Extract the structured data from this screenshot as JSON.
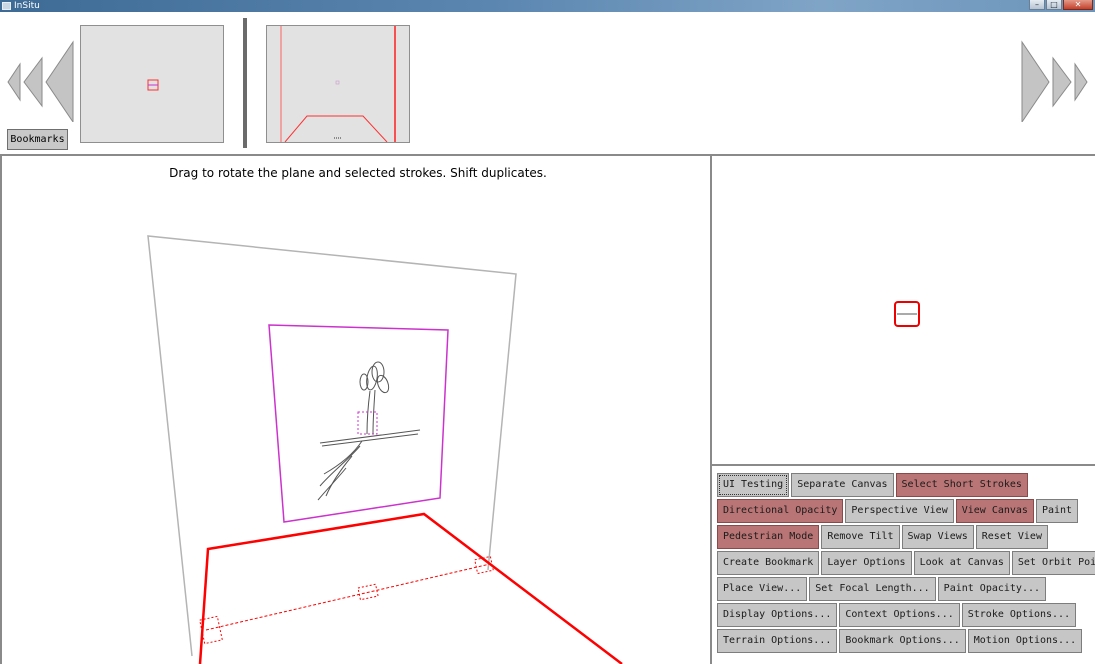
{
  "window": {
    "title": "InSitu",
    "minimize_glyph": "–",
    "maximize_glyph": "□",
    "close_glyph": "✕"
  },
  "top_strip": {
    "bookmarks_label": "Bookmarks",
    "prev_icon": "triple-left-triangles-icon",
    "next_icon": "triple-right-triangles-icon"
  },
  "main_view": {
    "instruction_text": "Drag to rotate the plane and selected strokes. Shift duplicates."
  },
  "colors": {
    "active_button": "#b97575",
    "button": "#c6c6c6",
    "canvas_outline": "#cc33cc",
    "ground_plane": "#ff0000",
    "back_plane": "#b4b4b4"
  },
  "buttons": {
    "rows": [
      [
        {
          "label": "UI Testing",
          "active": false,
          "focused": true
        },
        {
          "label": "Separate Canvas",
          "active": false
        },
        {
          "label": "Select Short Strokes",
          "active": true
        }
      ],
      [
        {
          "label": "Directional Opacity",
          "active": true
        },
        {
          "label": "Perspective View",
          "active": false
        },
        {
          "label": "View Canvas",
          "active": true
        },
        {
          "label": "Paint",
          "active": false
        }
      ],
      [
        {
          "label": "Pedestrian Mode",
          "active": true
        },
        {
          "label": "Remove Tilt",
          "active": false
        },
        {
          "label": "Swap Views",
          "active": false
        },
        {
          "label": "Reset View",
          "active": false
        }
      ],
      [
        {
          "label": "Create Bookmark",
          "active": false
        },
        {
          "label": "Layer Options",
          "active": false
        },
        {
          "label": "Look at Canvas",
          "active": false
        },
        {
          "label": "Set Orbit Point",
          "active": false
        }
      ],
      [
        {
          "label": "Place View...",
          "active": false
        },
        {
          "label": "Set Focal Length...",
          "active": false
        },
        {
          "label": "Paint Opacity...",
          "active": false
        }
      ],
      [
        {
          "label": "Display Options...",
          "active": false
        },
        {
          "label": "Context Options...",
          "active": false
        },
        {
          "label": "Stroke Options...",
          "active": false
        }
      ],
      [
        {
          "label": "Terrain Options...",
          "active": false
        },
        {
          "label": "Bookmark Options...",
          "active": false
        },
        {
          "label": "Motion Options...",
          "active": false
        }
      ]
    ]
  }
}
